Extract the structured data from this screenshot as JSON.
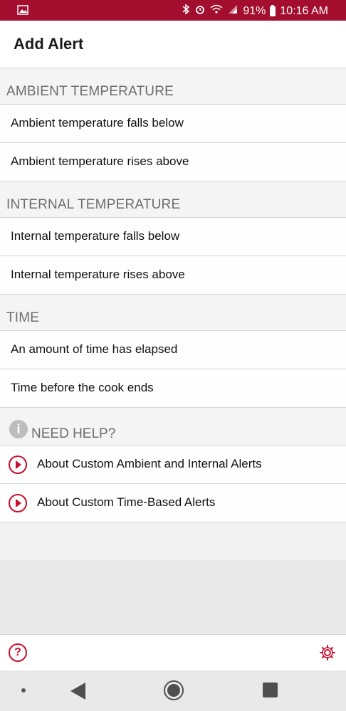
{
  "status_bar": {
    "battery_percent": "91%",
    "time": "10:16 AM",
    "icons": [
      "image-icon",
      "bluetooth-icon",
      "alarm-icon",
      "wifi-icon",
      "signal-icon",
      "battery-icon"
    ]
  },
  "header": {
    "title": "Add Alert"
  },
  "sections": [
    {
      "title": "AMBIENT TEMPERATURE",
      "items": [
        {
          "label": "Ambient temperature falls below"
        },
        {
          "label": "Ambient temperature rises above"
        }
      ]
    },
    {
      "title": "INTERNAL TEMPERATURE",
      "items": [
        {
          "label": "Internal temperature falls below"
        },
        {
          "label": "Internal temperature rises above"
        }
      ]
    },
    {
      "title": "TIME",
      "items": [
        {
          "label": "An amount of time has elapsed"
        },
        {
          "label": "Time before the cook ends"
        }
      ]
    }
  ],
  "help": {
    "title": "NEED HELP?",
    "info_glyph": "i",
    "items": [
      {
        "label": "About Custom Ambient and Internal Alerts"
      },
      {
        "label": "About Custom Time-Based Alerts"
      }
    ]
  },
  "toolbar": {
    "help_glyph": "?"
  },
  "colors": {
    "status_bar": "#a30d2e",
    "accent": "#c8102e",
    "section_text": "#6d6d6d"
  }
}
